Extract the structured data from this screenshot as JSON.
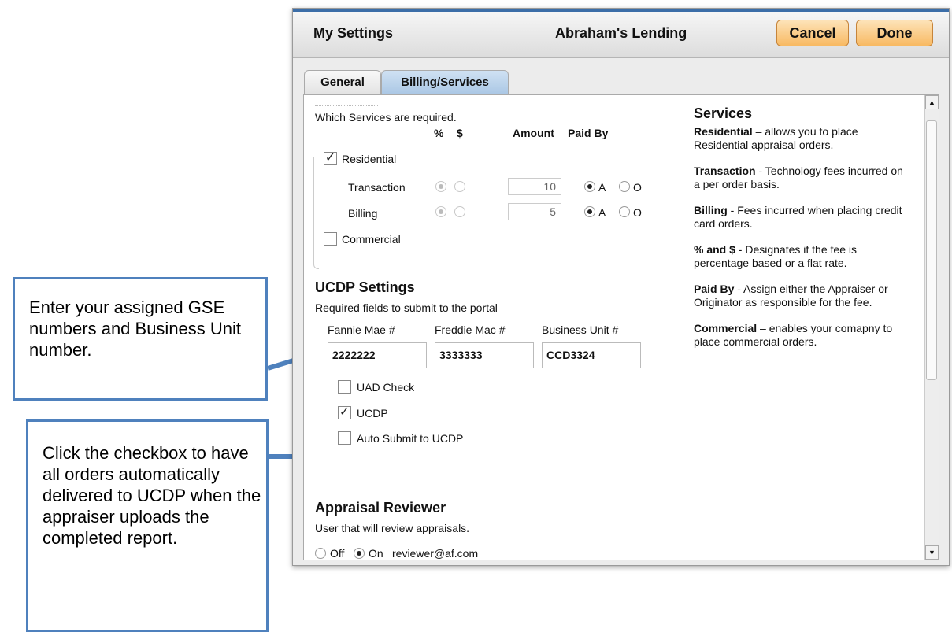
{
  "callouts": {
    "gse": "Enter your assigned GSE numbers and Business Unit number.",
    "auto": "Click the checkbox to have all orders automatically delivered to UCDP when the appraiser uploads the completed report."
  },
  "dialog": {
    "title": "My Settings",
    "company": "Abraham's Lending",
    "cancel": "Cancel",
    "done": "Done",
    "tabs": [
      "General",
      "Billing/Services"
    ]
  },
  "services": {
    "intro": "Which Services are required.",
    "col_pct": "%",
    "col_dollar": "$",
    "col_amount": "Amount",
    "col_paidby": "Paid By",
    "residential": "Residential",
    "transaction": "Transaction",
    "billing": "Billing",
    "commercial": "Commercial",
    "transaction_amount": "10",
    "billing_amount": "5",
    "opt_a": "A",
    "opt_o": "O"
  },
  "ucdp": {
    "heading": "UCDP Settings",
    "sub": "Required fields to submit to the portal",
    "fannie_label": "Fannie Mae #",
    "freddie_label": "Freddie Mac #",
    "bu_label": "Business Unit #",
    "fannie_value": "2222222",
    "freddie_value": "3333333",
    "bu_value": "CCD3324",
    "uad_check": "UAD Check",
    "ucdp": "UCDP",
    "auto_submit": "Auto Submit to UCDP"
  },
  "reviewer": {
    "heading": "Appraisal Reviewer",
    "sub": "User that will review appraisals.",
    "off": "Off",
    "on": "On",
    "email": "reviewer@af.com"
  },
  "sidebar": {
    "heading": "Services",
    "items": [
      {
        "term": "Residential",
        "desc": " – allows you to place Residential appraisal orders."
      },
      {
        "term": "Transaction",
        "desc": " - Technology fees incurred on a per order basis."
      },
      {
        "term": "Billing",
        "desc": " - Fees incurred when placing credit card orders."
      },
      {
        "term": "% and $",
        "desc": " - Designates if the fee is percentage based or a flat rate."
      },
      {
        "term": "Paid By",
        "desc": " - Assign either the Appraiser or Originator as responsible for the fee."
      },
      {
        "term": "Commercial",
        "desc": " – enables your comapny to place commercial orders."
      }
    ]
  }
}
